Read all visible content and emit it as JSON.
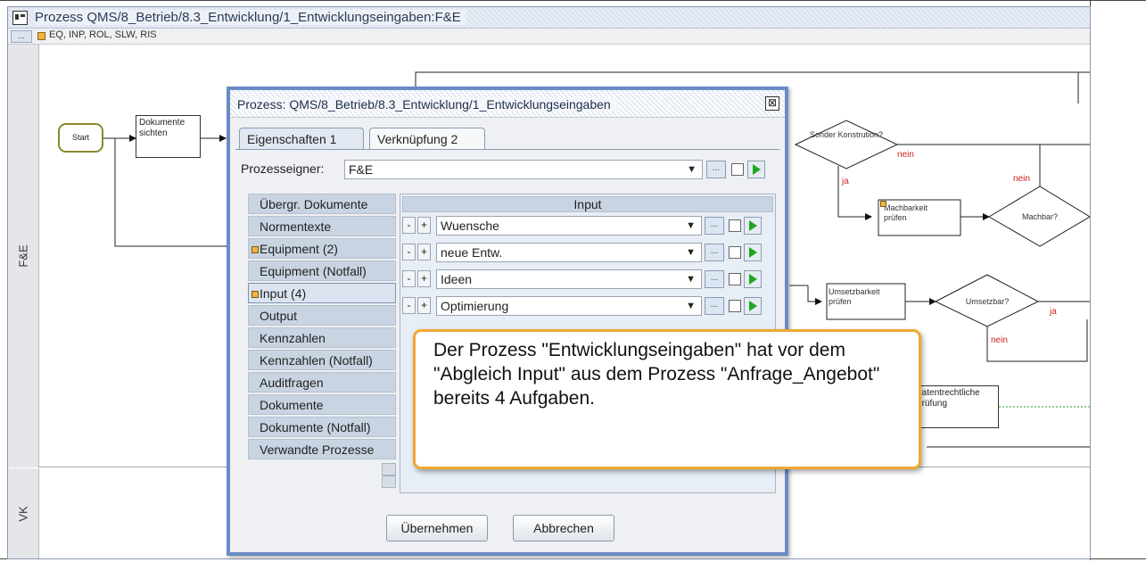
{
  "app": {
    "title": "Prozess QMS/8_Betrieb/8.3_Entwicklung/1_Entwicklungseingaben:F&E",
    "toolbar_button": "...",
    "subtitle": "EQ, INP, ROL, SLW, RIS"
  },
  "lanes": [
    {
      "label": "F&E"
    },
    {
      "label": "VK"
    }
  ],
  "diagram": {
    "start": "Start",
    "dokumente": "Dokumente sichten",
    "sonder": "Sonder Konstrution?",
    "machbarkeit": "Machbarkeit prüfen",
    "machbar": "Machbar?",
    "umsetzbarkeit": "Umsetzbarkeit prüfen",
    "umsetzbar": "Umsetzbar?",
    "patent": "Patentrechtliche Prüfung",
    "labels": {
      "nein": "nein",
      "ja": "ja"
    }
  },
  "dialog": {
    "title": "Prozess: QMS/8_Betrieb/8.3_Entwicklung/1_Entwicklungseingaben",
    "close": "⊠",
    "tabs": [
      {
        "label": "Eigenschaften 1"
      },
      {
        "label": "Verknüpfung 2"
      }
    ],
    "owner_label": "Prozesseigner:",
    "owner_value": "F&E",
    "dot_label": "...",
    "categories": [
      {
        "label": "Übergr. Dokumente",
        "indicator": false,
        "selected": false
      },
      {
        "label": "Normentexte",
        "indicator": false,
        "selected": false
      },
      {
        "label": "Equipment (2)",
        "indicator": true,
        "selected": false
      },
      {
        "label": "Equipment (Notfall)",
        "indicator": false,
        "selected": false
      },
      {
        "label": "Input (4)",
        "indicator": true,
        "selected": true
      },
      {
        "label": "Output",
        "indicator": false,
        "selected": false
      },
      {
        "label": "Kennzahlen",
        "indicator": false,
        "selected": false
      },
      {
        "label": "Kennzahlen (Notfall)",
        "indicator": false,
        "selected": false
      },
      {
        "label": "Auditfragen",
        "indicator": false,
        "selected": false
      },
      {
        "label": "Dokumente",
        "indicator": false,
        "selected": false
      },
      {
        "label": "Dokumente (Notfall)",
        "indicator": false,
        "selected": false
      },
      {
        "label": "Verwandte Prozesse",
        "indicator": false,
        "selected": false
      }
    ],
    "input_header": "Input",
    "input_rows": [
      {
        "minus": "-",
        "plus": "+",
        "value": "Wuensche"
      },
      {
        "minus": "-",
        "plus": "+",
        "value": "neue Entw."
      },
      {
        "minus": "-",
        "plus": "+",
        "value": "Ideen"
      },
      {
        "minus": "-",
        "plus": "+",
        "value": "Optimierung"
      }
    ],
    "ok_label": "Übernehmen",
    "cancel_label": "Abbrechen"
  },
  "callout": {
    "text": "Der Prozess \"Entwicklungseingaben\" hat vor dem \"Abgleich Input\" aus dem Prozess \"Anfrage_Angebot\" bereits 4 Aufgaben."
  },
  "colors": {
    "accent_border": "#6a8bc7",
    "callout_border": "#f0a830",
    "play_green": "#1fa81f",
    "indicator_orange": "#f0b53a",
    "branch_red": "#d02020"
  }
}
